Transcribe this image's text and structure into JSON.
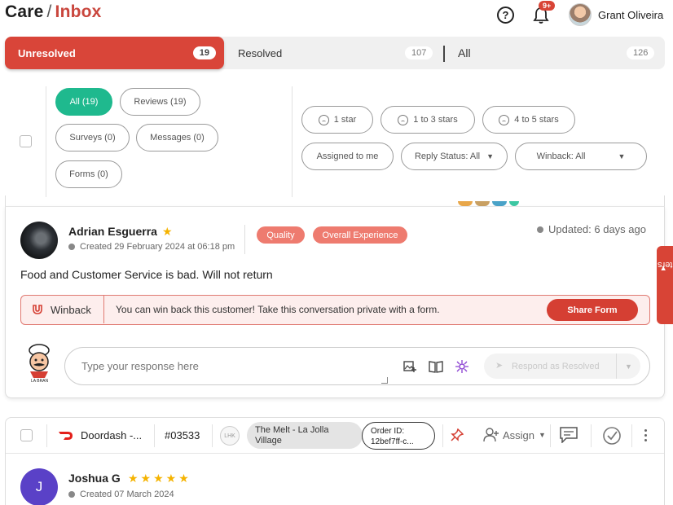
{
  "header": {
    "breadcrumb_root": "Care",
    "breadcrumb_sep": "/",
    "breadcrumb_current": "Inbox",
    "help_icon": "help-circle-icon",
    "notification_badge": "9+",
    "user_name": "Grant Oliveira"
  },
  "tabs": [
    {
      "label": "Unresolved",
      "count": "19"
    },
    {
      "label": "Resolved",
      "count": "107"
    },
    {
      "label": "All",
      "count": "126"
    }
  ],
  "type_filters": [
    {
      "label": "All (19)"
    },
    {
      "label": "Reviews (19)"
    },
    {
      "label": "Surveys (0)"
    },
    {
      "label": "Messages (0)"
    },
    {
      "label": "Forms (0)"
    }
  ],
  "rating_filters": [
    {
      "label": "1 star"
    },
    {
      "label": "1 to 3 stars"
    },
    {
      "label": "4 to 5 stars"
    }
  ],
  "dropdown_filters": [
    {
      "label": "Assigned to me"
    },
    {
      "label": "Reply Status: All"
    },
    {
      "label": "Winback: All"
    }
  ],
  "review1": {
    "customer": "Adrian Esguerra",
    "created": "Created 29 February 2024 at 06:18 pm",
    "updated": "Updated: 6 days ago",
    "tags": [
      "Quality",
      "Overall Experience"
    ],
    "text": "Food and Customer Service is bad. Will not return",
    "winback_label": "Winback",
    "winback_message": "You can win back this customer! Take this conversation private with a form.",
    "share_button": "Share Form",
    "response_placeholder": "Type your response here",
    "respond_button": "Respond as Resolved"
  },
  "filters_tab": "Filters",
  "review2": {
    "source": "Doordash -...",
    "ticket": "#03533",
    "location_initials": "LHK",
    "location": "The Melt - La Jolla Village",
    "order_label": "Order ID:",
    "order_id": "12bef7ff-c...",
    "assign_label": "Assign",
    "avatar_letter": "J",
    "customer": "Joshua G",
    "stars": "★★★★★",
    "created": "Created 07 March 2024"
  },
  "colors": {
    "brand_red": "#d94539",
    "active_green": "#1fb98e",
    "tag_coral": "#ee7b6f",
    "star_gold": "#f5b300",
    "avatar_purple": "#5a41c7"
  }
}
